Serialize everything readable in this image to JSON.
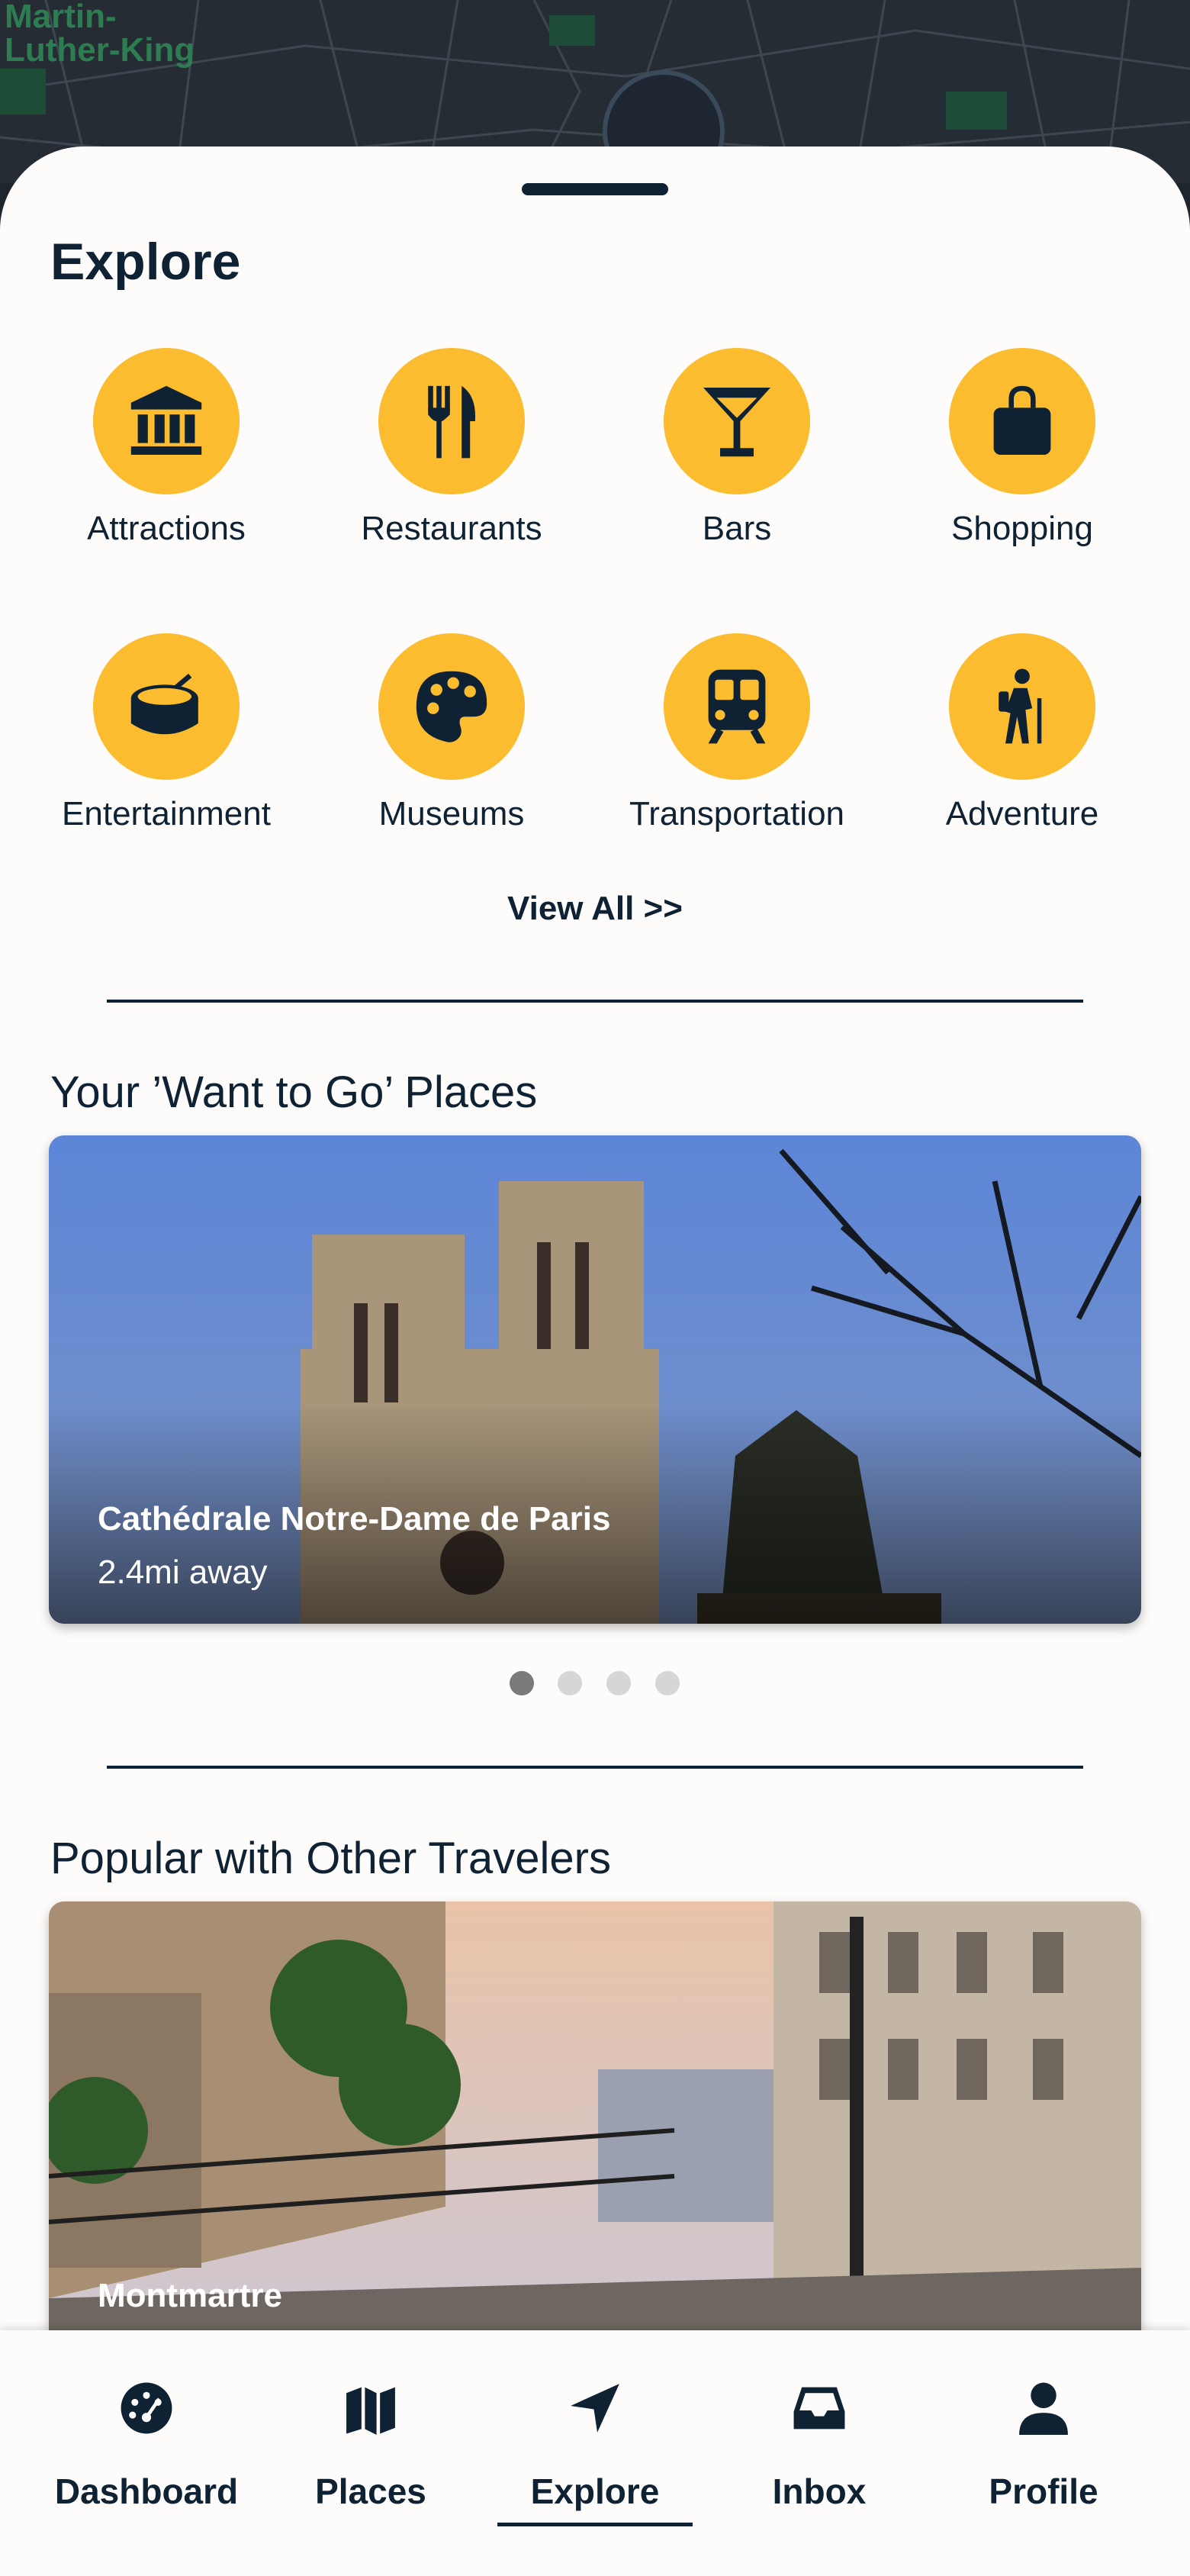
{
  "map": {
    "label": "Martin-\nLuther-King"
  },
  "explore": {
    "title": "Explore",
    "categories": [
      {
        "label": "Attractions",
        "icon": "bank-icon"
      },
      {
        "label": "Restaurants",
        "icon": "utensils-icon"
      },
      {
        "label": "Bars",
        "icon": "cocktail-icon"
      },
      {
        "label": "Shopping",
        "icon": "shopping-bag-icon"
      },
      {
        "label": "Entertainment",
        "icon": "drum-icon"
      },
      {
        "label": "Museums",
        "icon": "palette-icon"
      },
      {
        "label": "Transportation",
        "icon": "train-icon"
      },
      {
        "label": "Adventure",
        "icon": "hiking-icon"
      }
    ],
    "view_all": "View All >>"
  },
  "want_to_go": {
    "title": "Your ’Want to Go’ Places",
    "card": {
      "title": "Cathédrale Notre-Dame de Paris",
      "distance": "2.4mi away"
    },
    "pagination": {
      "count": 4,
      "active": 0
    }
  },
  "popular": {
    "title": "Popular with Other Travelers",
    "card": {
      "title": "Montmartre"
    }
  },
  "nav": {
    "items": [
      {
        "label": "Dashboard",
        "icon": "dashboard-gauge-icon"
      },
      {
        "label": "Places",
        "icon": "map-icon"
      },
      {
        "label": "Explore",
        "icon": "location-arrow-icon"
      },
      {
        "label": "Inbox",
        "icon": "inbox-tray-icon"
      },
      {
        "label": "Profile",
        "icon": "user-icon"
      }
    ],
    "active": "Explore"
  },
  "colors": {
    "accent": "#fbbd2f",
    "primary": "#0e2233",
    "sheet": "#fdfcfb"
  }
}
